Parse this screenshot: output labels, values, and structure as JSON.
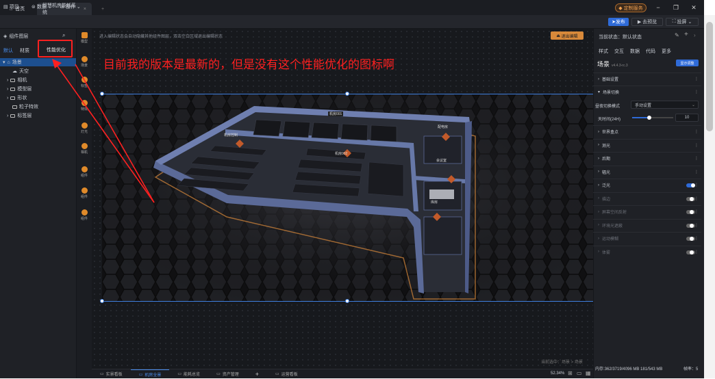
{
  "titlebar": {
    "home_tab": "首页",
    "app_tab": "智慧机房能耗系统",
    "new_tab": "+",
    "vip_label": "定制服务",
    "minimize": "−",
    "restore": "❐",
    "close": "✕"
  },
  "menubar": {
    "project": "项目",
    "data": "数据",
    "operate": "操作",
    "publish": "发布",
    "preview": "去预览",
    "display": "投屏"
  },
  "left_panel": {
    "title": "组件图层",
    "tabs": [
      "默认",
      "材质"
    ],
    "perf_button": "性能优化",
    "tree": [
      {
        "label": "场景",
        "selected": true,
        "level": 0
      },
      {
        "label": "天空",
        "selected": false,
        "level": 1
      },
      {
        "label": "相机",
        "selected": false,
        "level": 1
      },
      {
        "label": "模型层",
        "selected": false,
        "level": 1
      },
      {
        "label": "形状",
        "selected": false,
        "level": 1
      },
      {
        "label": "粒子特效",
        "selected": false,
        "level": 1
      },
      {
        "label": "标签层",
        "selected": false,
        "level": 1
      }
    ]
  },
  "left_rail": [
    {
      "label": "模型",
      "icon": "cube-icon"
    },
    {
      "label": "场景",
      "icon": "globe-icon"
    },
    {
      "label": "标签",
      "icon": "marker-icon"
    },
    {
      "label": "特效",
      "icon": "sparkle-icon"
    },
    {
      "label": "灯光",
      "icon": "light-icon"
    },
    {
      "label": "相机",
      "icon": "camera-icon"
    },
    {
      "label": "组件",
      "icon": "component-icon"
    }
  ],
  "canvas": {
    "hint": "进入编辑状态会自动隐藏其他组件图层，双击空白区域退出编辑状态",
    "exit_button": "退出编辑",
    "breadcrumb": "当前选中：场景 > 场景",
    "annotation": "目前我的版本是最新的，但是没有这个性能优化的图标啊",
    "scene_labels": [
      "机房001",
      "机房控制",
      "机房002",
      "会议室",
      "配电房",
      "库房"
    ]
  },
  "right_panel": {
    "status": "当前状态：默认状态",
    "tabs": [
      "样式",
      "交互",
      "数据",
      "代码",
      "更多"
    ],
    "component_name": "场景",
    "version": "v4.4.3-rc.3",
    "ai_button": "显示调整",
    "sections": [
      {
        "label": "基础设置",
        "type": "section",
        "dim": false
      },
      {
        "label": "场景切换",
        "type": "section",
        "dim": false
      }
    ],
    "mode_label": "昼夜切换模式",
    "mode_value": "手动设置",
    "time_label": "天时间(24H)",
    "time_value": "10",
    "time_fraction": 0.42,
    "more_sections": [
      {
        "label": "世界盒点",
        "dim": false,
        "toggle": null
      },
      {
        "label": "测光",
        "dim": false,
        "toggle": null
      },
      {
        "label": "后期",
        "dim": false,
        "toggle": null
      },
      {
        "label": "辐光",
        "dim": false,
        "toggle": null
      },
      {
        "label": "泛光",
        "dim": false,
        "toggle": "on"
      },
      {
        "label": "描边",
        "dim": true,
        "toggle": "off"
      },
      {
        "label": "屏幕空间反射",
        "dim": true,
        "toggle": "off"
      },
      {
        "label": "环境光遮蔽",
        "dim": true,
        "toggle": "off"
      },
      {
        "label": "运动模糊",
        "dim": true,
        "toggle": "off"
      },
      {
        "label": "体雾",
        "dim": true,
        "toggle": "off"
      }
    ],
    "stats_memory": "内存:362/3719/4096 MB 181/543 MB",
    "stats_fps": "帧率：5"
  },
  "bottombar": {
    "tabs": [
      {
        "label": "实景看板",
        "active": false
      },
      {
        "label": "机房全景",
        "active": true
      },
      {
        "label": "能耗总览",
        "active": false
      },
      {
        "label": "资产管理",
        "active": false
      },
      {
        "label": "+",
        "active": false
      },
      {
        "label": "运营看板",
        "active": false
      }
    ],
    "zoom": "52.34%"
  },
  "colors": {
    "accent": "#2f6bd8",
    "annotation_red": "#ff2020",
    "orange": "#d8893a"
  }
}
